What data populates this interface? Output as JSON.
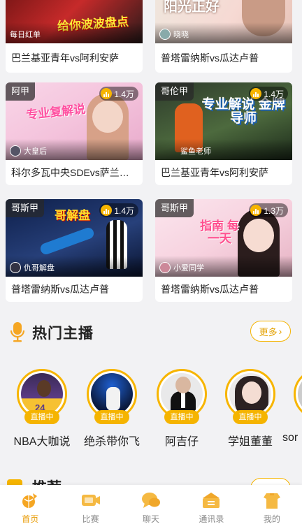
{
  "cards": [
    {
      "league": "",
      "heat": "",
      "anchor": "每日红单",
      "title": "巴兰基亚青年vs阿利安萨",
      "promo": "给你波波盘点"
    },
    {
      "league": "",
      "heat": "",
      "anchor": "晓晓",
      "title": "普塔雷纳斯vs瓜达卢普",
      "promo": "阳光正好"
    },
    {
      "league": "阿甲",
      "heat": "1.4万",
      "anchor": "大皇后",
      "title": "科尔多瓦中央SDEvs萨兰…",
      "promo": "专业复解说"
    },
    {
      "league": "哥伦甲",
      "heat": "1.4万",
      "anchor": "鲨鱼老师",
      "title": "巴兰基亚青年vs阿利安萨",
      "promo": "专业解说 金牌导师"
    },
    {
      "league": "哥斯甲",
      "heat": "1.4万",
      "anchor": "仇哥解盘",
      "title": "普塔雷纳斯vs瓜达卢普",
      "promo": "哥解盘"
    },
    {
      "league": "哥斯甲",
      "heat": "1.3万",
      "anchor": "小爱同学",
      "title": "普塔雷纳斯vs瓜达卢普",
      "promo": "指南 每一天"
    }
  ],
  "hot_section": {
    "title": "热门主播",
    "more": "更多"
  },
  "hosts": [
    {
      "name": "NBA大咖说",
      "badge": "直播中"
    },
    {
      "name": "绝杀带你飞",
      "badge": "直播中"
    },
    {
      "name": "阿吉仔",
      "badge": "直播中"
    },
    {
      "name": "学姐董董",
      "badge": "直播中"
    },
    {
      "name": "sor",
      "badge": ""
    }
  ],
  "next_section": {
    "title": "推荐"
  },
  "tabs": [
    {
      "label": "首页",
      "icon": "home-icon",
      "active": true
    },
    {
      "label": "比赛",
      "icon": "match-icon",
      "active": false
    },
    {
      "label": "聊天",
      "icon": "chat-icon",
      "active": false
    },
    {
      "label": "通讯录",
      "icon": "contacts-icon",
      "active": false
    },
    {
      "label": "我的",
      "icon": "profile-icon",
      "active": false
    }
  ],
  "colors": {
    "accent": "#f5b400",
    "active_tab": "#e89a00",
    "background": "#f2f2f4"
  }
}
